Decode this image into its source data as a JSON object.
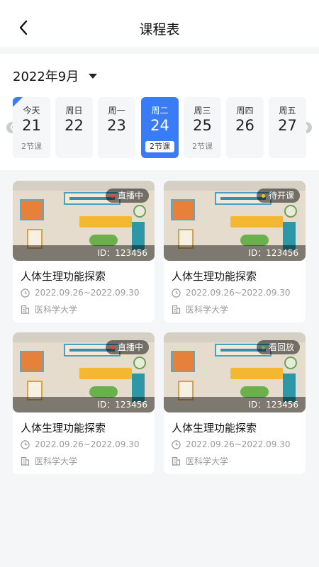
{
  "header": {
    "title": "课程表"
  },
  "calendar": {
    "month": "2022年9月",
    "days": [
      {
        "weekday": "今天",
        "date": "21",
        "count": "2节课",
        "today": true
      },
      {
        "weekday": "周日",
        "date": "22",
        "count": ""
      },
      {
        "weekday": "周一",
        "date": "23",
        "count": ""
      },
      {
        "weekday": "周二",
        "date": "24",
        "count": "2节课",
        "active": true
      },
      {
        "weekday": "周三",
        "date": "25",
        "count": "2节课"
      },
      {
        "weekday": "周四",
        "date": "26",
        "count": ""
      },
      {
        "weekday": "周五",
        "date": "27",
        "count": ""
      }
    ]
  },
  "courses": [
    {
      "status": "直播中",
      "status_color": "#ff3b30",
      "id_text": "ID：123456",
      "name": "人体生理功能探索",
      "date_range": "2022.09.26~2022.09.30",
      "school": "医科学大学"
    },
    {
      "status": "待开课",
      "status_color": "#ffc107",
      "id_text": "ID：123456",
      "name": "人体生理功能探索",
      "date_range": "2022.09.26~2022.09.30",
      "school": "医科学大学"
    },
    {
      "status": "直播中",
      "status_color": "#ff3b30",
      "id_text": "ID：123456",
      "name": "人体生理功能探索",
      "date_range": "2022.09.26~2022.09.30",
      "school": "医科学大学"
    },
    {
      "status": "看回放",
      "status_color": "#34c759",
      "id_text": "ID：123456",
      "name": "人体生理功能探索",
      "date_range": "2022.09.26~2022.09.30",
      "school": "医科学大学"
    }
  ],
  "colors": {
    "accent": "#3a7bf6",
    "background": "#f5f6f8"
  }
}
